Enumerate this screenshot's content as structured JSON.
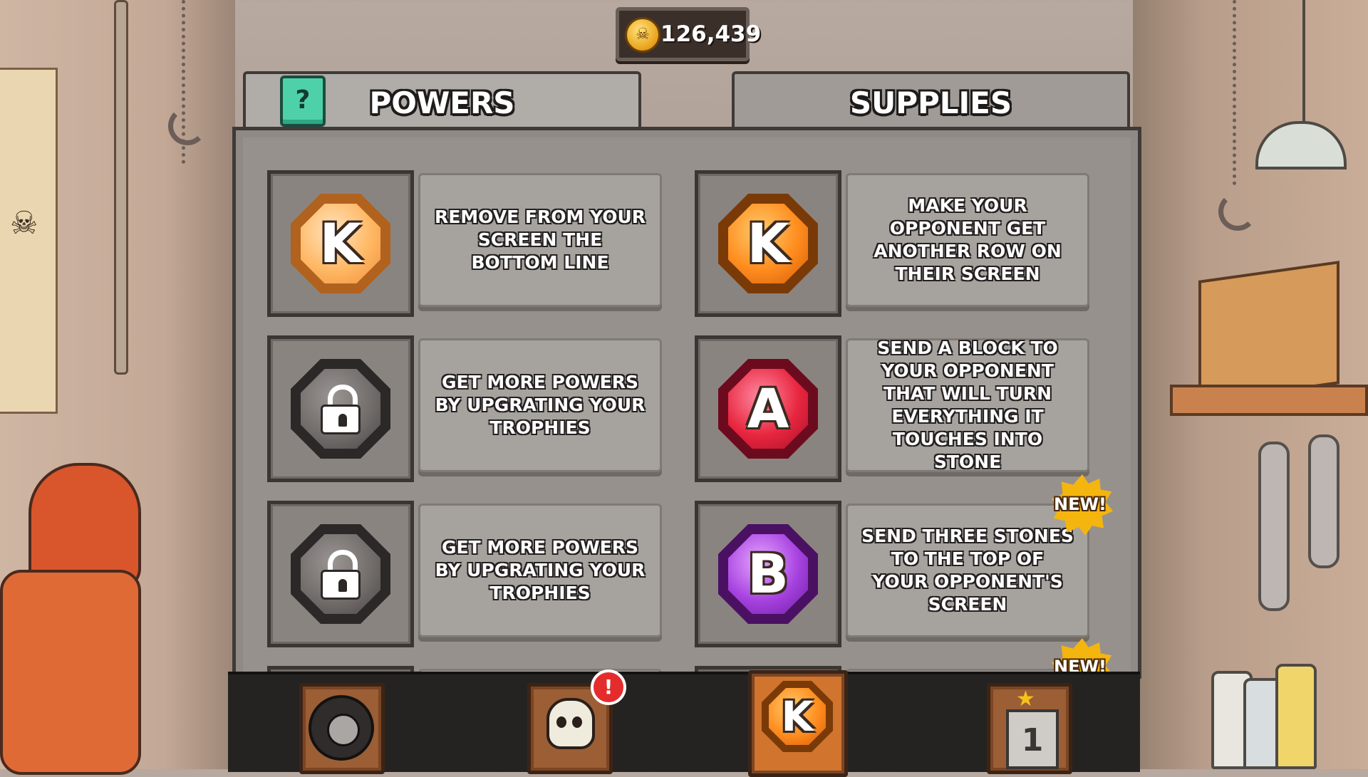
{
  "currency": {
    "coins": "126,439",
    "icon": "skull-coin-icon"
  },
  "tabs": {
    "help_label": "?",
    "powers": "POWERS",
    "supplies": "SUPPLIES"
  },
  "powers": [
    {
      "gem_letter": "K",
      "gem_color": "#ffb865",
      "locked": false,
      "description": "REMOVE FROM YOUR SCREEN THE BOTTOM LINE"
    },
    {
      "gem_letter": "",
      "locked": true,
      "icon": "lock-icon",
      "description": "GET MORE POWERS BY UPGRATING YOUR TROPHIES"
    },
    {
      "gem_letter": "",
      "locked": true,
      "icon": "lock-icon",
      "description": "GET MORE POWERS BY UPGRATING YOUR TROPHIES"
    }
  ],
  "supplies": [
    {
      "gem_letter": "K",
      "gem_color": "#ff8c1e",
      "description": "MAKE YOUR OPPONENT GET ANOTHER ROW ON THEIR SCREEN",
      "new": false
    },
    {
      "gem_letter": "A",
      "gem_color": "#e8263f",
      "description": "SEND A BLOCK TO YOUR OPPONENT THAT WILL TURN EVERYTHING IT TOUCHES INTO STONE",
      "new": false
    },
    {
      "gem_letter": "B",
      "gem_color": "#a742e0",
      "description": "SEND THREE STONES TO THE TOP OF YOUR OPPONENT'S SCREEN",
      "new": true
    }
  ],
  "badges": {
    "new_label": "NEW!"
  },
  "bottom_nav": {
    "items": [
      {
        "icon": "tire-icon",
        "active": false
      },
      {
        "icon": "skull-swords-icon",
        "active": false,
        "alert": "!"
      },
      {
        "icon": "gem-k-icon",
        "active": true,
        "letter": "K"
      },
      {
        "icon": "trophy-podium-icon",
        "active": false,
        "number": "1"
      }
    ]
  }
}
